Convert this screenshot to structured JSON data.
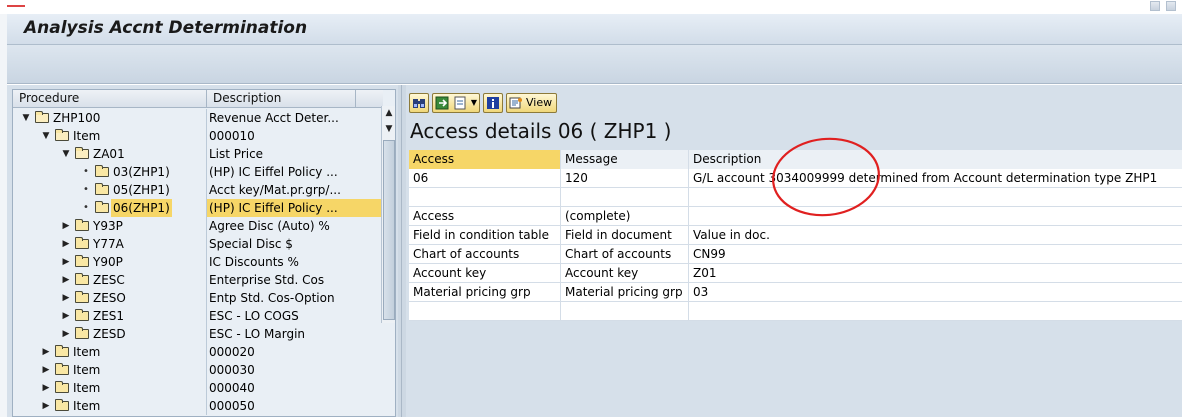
{
  "window": {
    "title": "Analysis Accnt Determination"
  },
  "tree": {
    "columns": [
      "Procedure",
      "Description"
    ],
    "rows": [
      {
        "label": "ZHP100",
        "desc": "Revenue Acct Deter...",
        "level": 0,
        "toggle": "open"
      },
      {
        "label": "Item",
        "desc": "000010",
        "level": 1,
        "toggle": "open"
      },
      {
        "label": "ZA01",
        "desc": "List Price",
        "level": 2,
        "toggle": "open"
      },
      {
        "label": "03(ZHP1)",
        "desc": "(HP) IC Eiffel Policy ...",
        "level": 3,
        "toggle": "leaf"
      },
      {
        "label": "05(ZHP1)",
        "desc": "Acct key/Mat.pr.grp/...",
        "level": 3,
        "toggle": "leaf"
      },
      {
        "label": "06(ZHP1)",
        "desc": "(HP) IC Eiffel Policy ...",
        "level": 3,
        "toggle": "leaf",
        "selected": true
      },
      {
        "label": "Y93P",
        "desc": "Agree Disc (Auto) %",
        "level": 2,
        "toggle": "closed"
      },
      {
        "label": "Y77A",
        "desc": "Special Disc     $",
        "level": 2,
        "toggle": "closed"
      },
      {
        "label": "Y90P",
        "desc": "IC Discounts %",
        "level": 2,
        "toggle": "closed"
      },
      {
        "label": "ZESC",
        "desc": "Enterprise Std. Cos",
        "level": 2,
        "toggle": "closed"
      },
      {
        "label": "ZESO",
        "desc": "Entp Std. Cos-Option",
        "level": 2,
        "toggle": "closed"
      },
      {
        "label": "ZES1",
        "desc": "ESC - LO COGS",
        "level": 2,
        "toggle": "closed"
      },
      {
        "label": "ZESD",
        "desc": "ESC - LO Margin",
        "level": 2,
        "toggle": "closed"
      },
      {
        "label": "Item",
        "desc": "000020",
        "level": 1,
        "toggle": "closed"
      },
      {
        "label": "Item",
        "desc": "000030",
        "level": 1,
        "toggle": "closed"
      },
      {
        "label": "Item",
        "desc": "000040",
        "level": 1,
        "toggle": "closed"
      },
      {
        "label": "Item",
        "desc": "000050",
        "level": 1,
        "toggle": "closed"
      }
    ]
  },
  "toolbar": {
    "view_label": "View",
    "icons": [
      "binoculars-icon",
      "export-icon",
      "info-icon",
      "view-icon"
    ]
  },
  "details": {
    "heading": "Access details 06 ( ZHP1 )",
    "header": [
      "Access",
      "Message",
      "Description"
    ],
    "rows": [
      [
        "06",
        "120",
        "G/L account 3034009999 determined from Account determination type ZHP1"
      ],
      [
        "",
        "",
        ""
      ],
      [
        "Access",
        "(complete)",
        ""
      ],
      [
        "Field in condition table",
        "Field in document",
        "Value in doc."
      ],
      [
        "Chart of accounts",
        "Chart of accounts",
        "CN99"
      ],
      [
        "Account key",
        "Account key",
        "Z01"
      ],
      [
        "Material pricing grp",
        "Material pricing grp",
        "03"
      ],
      [
        "",
        "",
        ""
      ]
    ]
  },
  "colors": {
    "selection": "#f6d667",
    "annotation": "#e02020",
    "panel_bg": "#d6e0ea"
  }
}
